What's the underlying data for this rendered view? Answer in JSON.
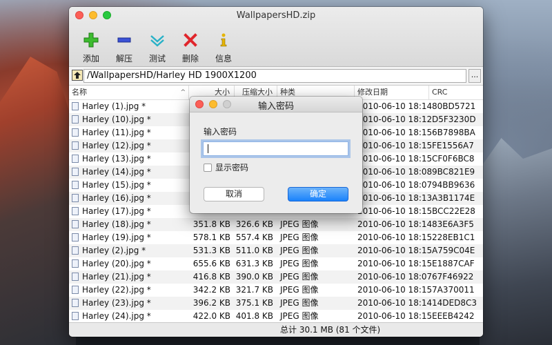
{
  "window": {
    "title": "WallpapersHD.zip"
  },
  "toolbar": [
    {
      "label": "添加",
      "icon": "add-icon"
    },
    {
      "label": "解压",
      "icon": "extract-icon"
    },
    {
      "label": "测试",
      "icon": "test-icon"
    },
    {
      "label": "删除",
      "icon": "delete-icon"
    },
    {
      "label": "信息",
      "icon": "info-icon"
    }
  ],
  "pathbar": {
    "path": "/WallpapersHD/Harley HD 1900X1200",
    "more_label": "..."
  },
  "table": {
    "columns": {
      "name": "名称",
      "size": "大小",
      "packed": "压缩大小",
      "type": "种类",
      "modified": "修改日期",
      "crc": "CRC"
    },
    "rows": [
      {
        "name": "Harley (1).jpg *",
        "size": "",
        "packed": "",
        "type": "",
        "modified": "2010-06-10 18:14",
        "crc": "80BD5721"
      },
      {
        "name": "Harley (10).jpg *",
        "size": "",
        "packed": "",
        "type": "",
        "modified": "2010-06-10 18:12",
        "crc": "D5F3230D"
      },
      {
        "name": "Harley (11).jpg *",
        "size": "",
        "packed": "",
        "type": "",
        "modified": "2010-06-10 18:15",
        "crc": "6B7898BA"
      },
      {
        "name": "Harley (12).jpg *",
        "size": "",
        "packed": "",
        "type": "",
        "modified": "2010-06-10 18:15",
        "crc": "FE1556A7"
      },
      {
        "name": "Harley (13).jpg *",
        "size": "",
        "packed": "",
        "type": "",
        "modified": "2010-06-10 18:15",
        "crc": "CF0F6BC8"
      },
      {
        "name": "Harley (14).jpg *",
        "size": "",
        "packed": "",
        "type": "",
        "modified": "2010-06-10 18:08",
        "crc": "9BC821E9"
      },
      {
        "name": "Harley (15).jpg *",
        "size": "",
        "packed": "",
        "type": "",
        "modified": "2010-06-10 18:07",
        "crc": "94BB9636"
      },
      {
        "name": "Harley (16).jpg *",
        "size": "",
        "packed": "",
        "type": "",
        "modified": "2010-06-10 18:13",
        "crc": "A3B1174E"
      },
      {
        "name": "Harley (17).jpg *",
        "size": "",
        "packed": "",
        "type": "",
        "modified": "2010-06-10 18:15",
        "crc": "BCC22E28"
      },
      {
        "name": "Harley (18).jpg *",
        "size": "351.8 KB",
        "packed": "326.6 KB",
        "type": "JPEG 图像",
        "modified": "2010-06-10 18:14",
        "crc": "83E6A3F5"
      },
      {
        "name": "Harley (19).jpg *",
        "size": "578.1 KB",
        "packed": "557.4 KB",
        "type": "JPEG 图像",
        "modified": "2010-06-10 18:15",
        "crc": "228EB1C1"
      },
      {
        "name": "Harley (2).jpg *",
        "size": "531.3 KB",
        "packed": "511.0 KB",
        "type": "JPEG 图像",
        "modified": "2010-06-10 18:15",
        "crc": "A759C04E"
      },
      {
        "name": "Harley (20).jpg *",
        "size": "655.6 KB",
        "packed": "631.3 KB",
        "type": "JPEG 图像",
        "modified": "2010-06-10 18:15",
        "crc": "E1887CAF"
      },
      {
        "name": "Harley (21).jpg *",
        "size": "416.8 KB",
        "packed": "390.0 KB",
        "type": "JPEG 图像",
        "modified": "2010-06-10 18:07",
        "crc": "67F46922"
      },
      {
        "name": "Harley (22).jpg *",
        "size": "342.2 KB",
        "packed": "321.7 KB",
        "type": "JPEG 图像",
        "modified": "2010-06-10 18:15",
        "crc": "7A370011"
      },
      {
        "name": "Harley (23).jpg *",
        "size": "396.2 KB",
        "packed": "375.1 KB",
        "type": "JPEG 图像",
        "modified": "2010-06-10 18:14",
        "crc": "14DED8C3"
      },
      {
        "name": "Harley (24).jpg *",
        "size": "422.0 KB",
        "packed": "401.8 KB",
        "type": "JPEG 图像",
        "modified": "2010-06-10 18:15",
        "crc": "EEEB4242"
      }
    ]
  },
  "status": {
    "text": "总计 30.1 MB (81 个文件)"
  },
  "dialog": {
    "title": "输入密码",
    "prompt": "输入密码",
    "password_value": "",
    "show_password_label": "显示密码",
    "show_password_checked": false,
    "cancel_label": "取消",
    "ok_label": "确定"
  },
  "colors": {
    "accent": "#1a82fb",
    "focus_ring": "#8fb4e6"
  }
}
